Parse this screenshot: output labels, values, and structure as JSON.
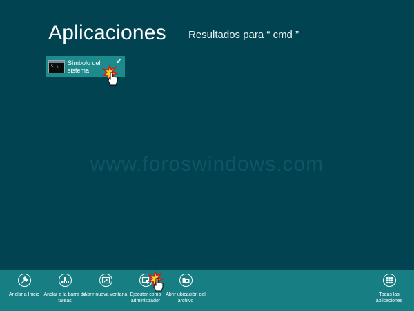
{
  "header": {
    "title": "Aplicaciones",
    "results_label": "Resultados para “ cmd ”"
  },
  "results": [
    {
      "label": "Símbolo del sistema",
      "icon": "command-prompt-icon",
      "selected": true
    }
  ],
  "watermark": "www.foroswindows.com",
  "app_bar": {
    "commands": [
      {
        "label": "Anclar a Inicio",
        "icon": "pin-icon"
      },
      {
        "label": "Anclar a la barra de tareas",
        "icon": "taskbar-icon"
      },
      {
        "label": "Abrir nueva ventana",
        "icon": "new-window-icon"
      },
      {
        "label": "Ejecutar como administrador",
        "icon": "run-as-admin-icon"
      },
      {
        "label": "Abrir ubicación del archivo",
        "icon": "folder-icon"
      },
      {
        "label": "Todas las aplicaciones",
        "icon": "all-apps-icon"
      }
    ]
  },
  "colors": {
    "background": "#024352",
    "tile": "#1d8b8c",
    "app_bar": "#177f83"
  }
}
